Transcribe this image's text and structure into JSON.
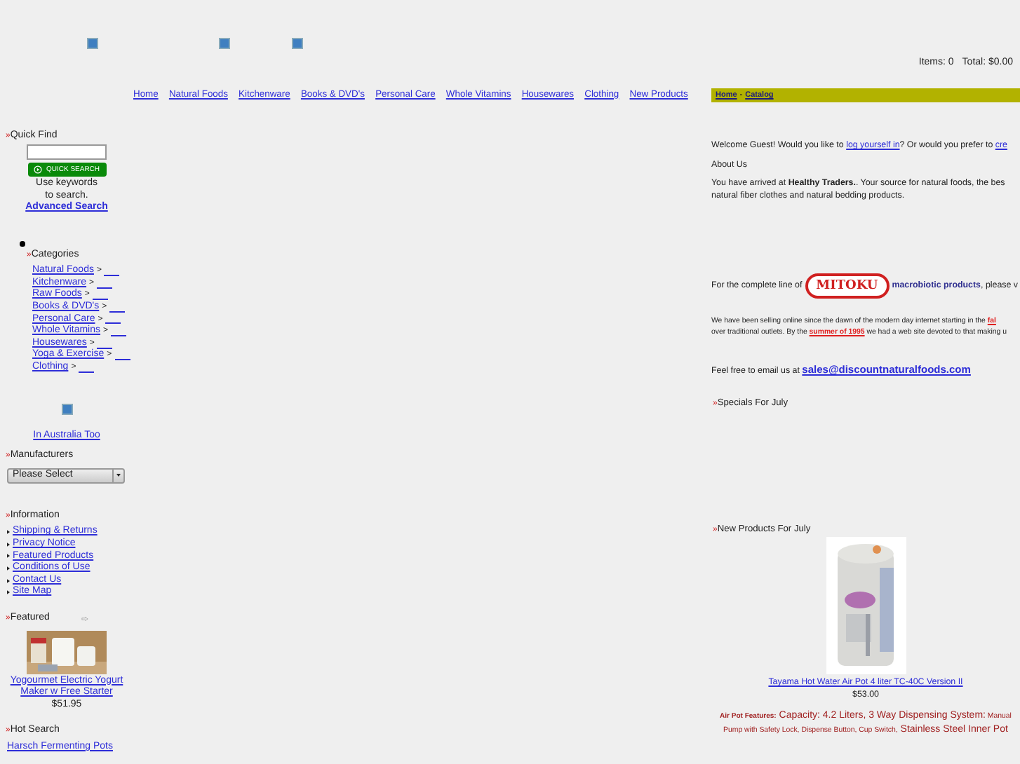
{
  "cart": {
    "items": "Items: 0",
    "total": "Total: $0.00"
  },
  "nav": [
    "Home",
    "Natural Foods",
    "Kitchenware",
    "Books & DVD's",
    "Personal Care",
    "Whole Vitamins",
    "Housewares",
    "Clothing",
    "New Products"
  ],
  "breadcrumb": {
    "items": [
      "Home",
      "Catalog"
    ],
    "separator": "-"
  },
  "quick_find": {
    "heading": {
      "bullet": "»",
      "text": "Quick Find"
    },
    "button": "QUICK SEARCH",
    "hint": [
      "Use keywords",
      "to search."
    ],
    "link": "Advanced Search"
  },
  "categories": {
    "heading": {
      "bullet": "»",
      "text": "Categories"
    },
    "items": [
      {
        "label": "Natural Foods",
        "mark": ">"
      },
      {
        "label": "Kitchenware",
        "mark": ">"
      },
      {
        "label": "Raw Foods",
        "mark": ">"
      },
      {
        "label": "Books & DVD's",
        "mark": ">"
      },
      {
        "label": "Personal Care",
        "mark": ">"
      },
      {
        "label": "Whole Vitamins",
        "mark": ">"
      },
      {
        "label": "Housewares",
        "mark": ">"
      },
      {
        "label": "Yoga & Exercise",
        "mark": ">"
      },
      {
        "label": "Clothing",
        "mark": ">"
      }
    ]
  },
  "australia_link": "In Australia Too",
  "manufacturers": {
    "heading": {
      "bullet": "»",
      "text": "Manufacturers"
    },
    "select": "Please Select"
  },
  "information": {
    "heading": {
      "bullet": "»",
      "text": "Information"
    },
    "links": [
      "Shipping & Returns",
      "Privacy Notice",
      "Featured Products",
      "Conditions of Use",
      "Contact Us",
      "Site Map"
    ]
  },
  "featured": {
    "heading": {
      "bullet": "»",
      "text": "Featured"
    },
    "name": "Yogourmet Electric Yogurt Maker w Free Starter",
    "price": "$51.95"
  },
  "hot_search": {
    "heading": {
      "bullet": "»",
      "text": "Hot Search"
    },
    "links": [
      "Harsch Fermenting Pots"
    ]
  },
  "welcome": [
    {
      "kind": "text",
      "text": "Welcome Guest! Would you like to "
    },
    {
      "kind": "link",
      "text": "log yourself in"
    },
    {
      "kind": "text",
      "text": "? Or would you prefer to "
    },
    {
      "kind": "link",
      "text": "cre"
    }
  ],
  "about": {
    "heading": "About Us",
    "lines": [
      "You have arrived at **Healthy Traders.**. Your source for natural foods, the bes",
      "natural fiber clothes and natural bedding products."
    ]
  },
  "mitoku": {
    "before": "For the complete line of",
    "logo": "MITOKU",
    "link": "macrobiotic products",
    "after": ", please v"
  },
  "history": [
    [
      {
        "kind": "text",
        "text": "We have been selling online since the dawn of the modern day internet starting in the "
      },
      {
        "kind": "redlink",
        "text": "fal"
      }
    ],
    [
      {
        "kind": "text",
        "text": "over traditional outlets. By the "
      },
      {
        "kind": "redlink",
        "text": "summer of 1995"
      },
      {
        "kind": "text",
        "text": " we had a web site devoted to that making u"
      }
    ]
  ],
  "email": {
    "text": "Feel free to email us at",
    "link": "sales@discountnaturalfoods.com"
  },
  "specials": {
    "heading": {
      "bullet": "»",
      "text": "Specials For July"
    }
  },
  "new_products": {
    "heading": {
      "bullet": "»",
      "text": "New Products For July"
    },
    "name": "Tayama Hot Water Air Pot 4 liter TC-40C Version II",
    "price": "$53.00",
    "features": [
      {
        "kind": "label",
        "text": "Air Pot Features:"
      },
      {
        "kind": "big",
        "text": " Capacity: 4.2 Liters,  3 Way Dispensing System:"
      },
      {
        "kind": "small",
        "text": " Manual Pump with Safety Lock, Dispense Button, Cup Switch,"
      },
      {
        "kind": "big",
        "text": " Stainless Steel Inner Pot"
      }
    ]
  }
}
